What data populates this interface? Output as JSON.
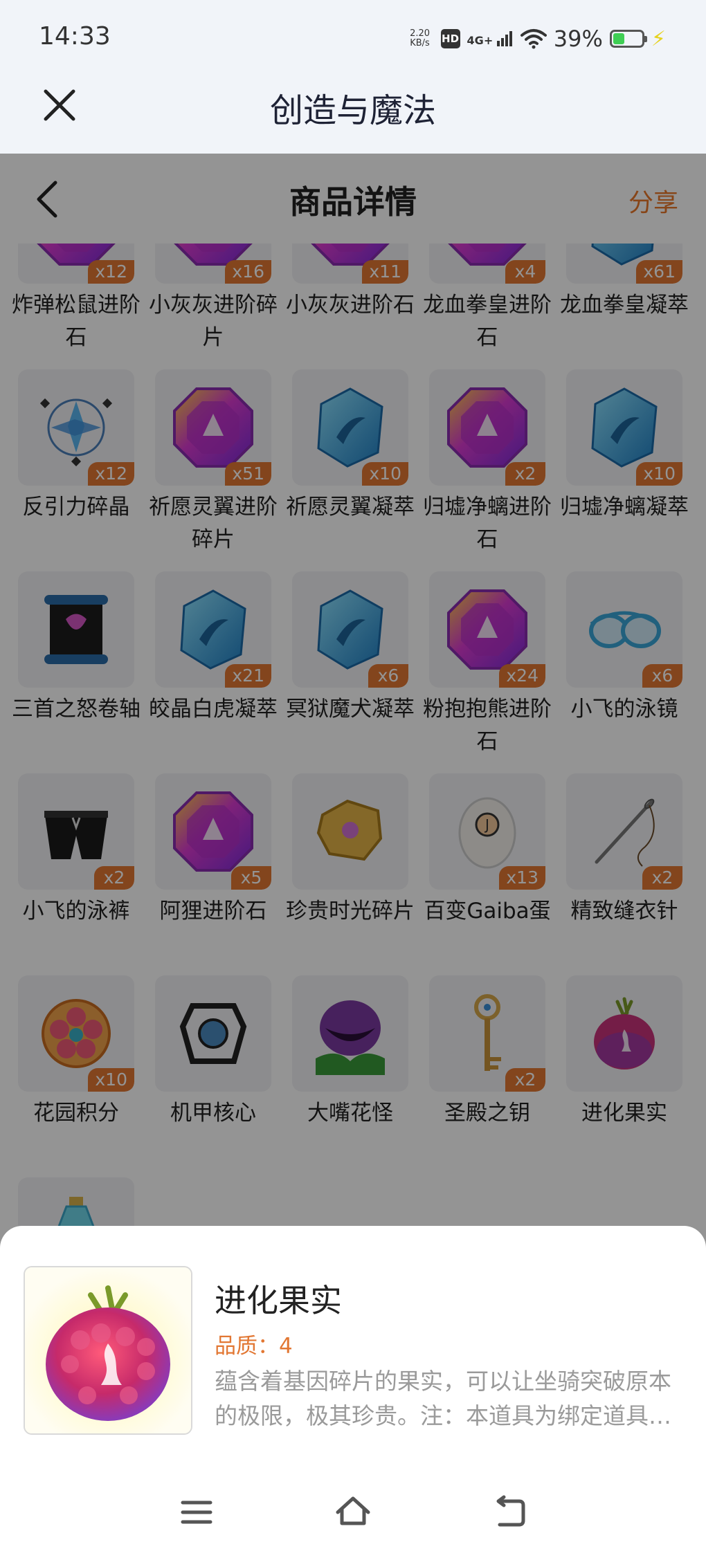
{
  "status": {
    "time": "14:33",
    "speed_value": "2.20",
    "speed_unit": "KB/s",
    "hd": "HD",
    "network": "4G+",
    "battery_pct": "39%",
    "battery_level": 0.39
  },
  "app": {
    "title": "创造与魔法"
  },
  "web": {
    "title": "商品详情",
    "share": "分享"
  },
  "items": [
    {
      "label": "炸弹松鼠进阶石",
      "count": "x12",
      "icon": "purple-gem-icon"
    },
    {
      "label": "小灰灰进阶碎片",
      "count": "x16",
      "icon": "purple-gem-icon"
    },
    {
      "label": "小灰灰进阶石",
      "count": "x11",
      "icon": "purple-gem-icon"
    },
    {
      "label": "龙血拳皇进阶石",
      "count": "x4",
      "icon": "purple-gem-icon"
    },
    {
      "label": "龙血拳皇凝萃",
      "count": "x61",
      "icon": "blue-crystal-icon"
    },
    {
      "label": "反引力碎晶",
      "count": "x12",
      "icon": "anti-gravity-crystal-icon"
    },
    {
      "label": "祈愿灵翼进阶碎片",
      "count": "x51",
      "icon": "purple-gem-icon"
    },
    {
      "label": "祈愿灵翼凝萃",
      "count": "x10",
      "icon": "blue-crystal-icon"
    },
    {
      "label": "归墟净螭进阶石",
      "count": "x2",
      "icon": "purple-gem-icon"
    },
    {
      "label": "归墟净螭凝萃",
      "count": "x10",
      "icon": "blue-crystal-icon"
    },
    {
      "label": "三首之怒卷轴",
      "count": "",
      "icon": "scroll-icon"
    },
    {
      "label": "皎晶白虎凝萃",
      "count": "x21",
      "icon": "blue-crystal-icon"
    },
    {
      "label": "冥狱魔犬凝萃",
      "count": "x6",
      "icon": "blue-crystal-icon"
    },
    {
      "label": "粉抱抱熊进阶石",
      "count": "x24",
      "icon": "purple-gem-icon"
    },
    {
      "label": "小飞的泳镜",
      "count": "x6",
      "icon": "goggles-icon"
    },
    {
      "label": "小飞的泳裤",
      "count": "x2",
      "icon": "swim-trunks-icon"
    },
    {
      "label": "阿狸进阶石",
      "count": "x5",
      "icon": "purple-gem-icon"
    },
    {
      "label": "珍贵时光碎片",
      "count": "",
      "icon": "time-fragment-icon"
    },
    {
      "label": "百变Gaiba蛋",
      "count": "x13",
      "icon": "egg-icon"
    },
    {
      "label": "精致缝衣针",
      "count": "x2",
      "icon": "needle-icon"
    },
    {
      "label": "花园积分",
      "count": "x10",
      "icon": "flower-token-icon"
    },
    {
      "label": "机甲核心",
      "count": "",
      "icon": "mech-core-icon"
    },
    {
      "label": "大嘴花怪",
      "count": "",
      "icon": "piranha-plant-icon"
    },
    {
      "label": "圣殿之钥",
      "count": "x2",
      "icon": "key-icon"
    },
    {
      "label": "进化果实",
      "count": "",
      "icon": "evolution-fruit-icon"
    },
    {
      "label": "",
      "count": "",
      "icon": "potion-icon"
    }
  ],
  "detail": {
    "name": "进化果实",
    "quality": "品质：4",
    "description": "蕴含着基因碎片的果实，可以让坐骑突破原本的极限，极其珍贵。注：本道具为绑定道具，无法交易。",
    "icon": "evolution-fruit-icon"
  },
  "nav": {
    "buttons": [
      "menu-icon",
      "home-icon",
      "back-icon"
    ]
  },
  "colors": {
    "accent": "#e27733",
    "share": "#e8772a",
    "title": "#1e2235",
    "appbar_bg": "#f1f4f9"
  }
}
